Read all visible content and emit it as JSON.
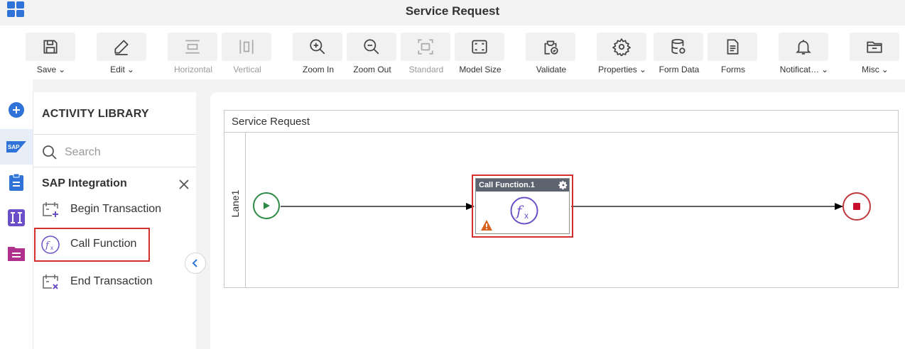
{
  "app": {
    "title": "Service Request"
  },
  "toolbar": {
    "items": [
      {
        "label": "Save",
        "icon": "save-icon",
        "dropdown": true,
        "disabled": false
      },
      {
        "label": "Edit",
        "icon": "pencil-icon",
        "dropdown": true,
        "disabled": false
      },
      {
        "label": "Horizontal",
        "icon": "horizontal-layout-icon",
        "dropdown": false,
        "disabled": true
      },
      {
        "label": "Vertical",
        "icon": "vertical-layout-icon",
        "dropdown": false,
        "disabled": true
      },
      {
        "label": "Zoom In",
        "icon": "zoom-in-icon",
        "dropdown": false,
        "disabled": false
      },
      {
        "label": "Zoom Out",
        "icon": "zoom-out-icon",
        "dropdown": false,
        "disabled": false
      },
      {
        "label": "Standard",
        "icon": "standard-view-icon",
        "dropdown": false,
        "disabled": true
      },
      {
        "label": "Model Size",
        "icon": "fit-to-screen-icon",
        "dropdown": false,
        "disabled": false
      },
      {
        "label": "Validate",
        "icon": "validate-icon",
        "dropdown": false,
        "disabled": false
      },
      {
        "label": "Properties",
        "icon": "gear-icon",
        "dropdown": true,
        "disabled": false
      },
      {
        "label": "Form Data",
        "icon": "database-icon",
        "dropdown": false,
        "disabled": false
      },
      {
        "label": "Forms",
        "icon": "forms-icon",
        "dropdown": false,
        "disabled": false
      },
      {
        "label": "Notificat…",
        "icon": "bell-icon",
        "dropdown": true,
        "disabled": false
      },
      {
        "label": "Misc",
        "icon": "folder-icon",
        "dropdown": true,
        "disabled": false
      }
    ]
  },
  "rail": {
    "items": [
      {
        "icon": "add-circle-icon",
        "active": false
      },
      {
        "icon": "sap-logo-icon",
        "active": true
      },
      {
        "icon": "clipboard-icon",
        "active": false
      },
      {
        "icon": "integration-icon",
        "active": false
      },
      {
        "icon": "document-icon",
        "active": false
      }
    ]
  },
  "library": {
    "title": "ACTIVITY LIBRARY",
    "search_placeholder": "Search",
    "section": "SAP Integration",
    "items": [
      {
        "label": "Begin Transaction",
        "icon": "begin-transaction-icon",
        "selected": false
      },
      {
        "label": "Call Function",
        "icon": "function-icon",
        "selected": true
      },
      {
        "label": "End Transaction",
        "icon": "end-transaction-icon",
        "selected": false
      }
    ]
  },
  "canvas": {
    "pool_title": "Service Request",
    "lane_label": "Lane1",
    "task": {
      "title": "Call Function.1",
      "icon": "function-icon",
      "warning": true
    }
  },
  "colors": {
    "accent_blue": "#2f73d9",
    "selection_red": "#d32f2f",
    "start_green": "#2e8b47",
    "end_red": "#c0393b",
    "function_purple": "#6b4fc8"
  }
}
